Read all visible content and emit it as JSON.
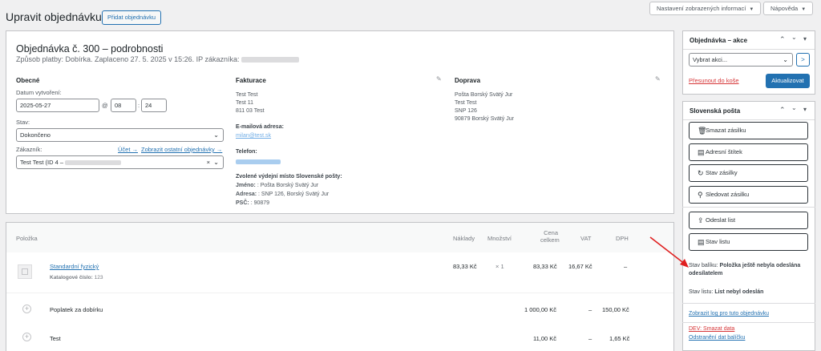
{
  "top": {
    "screen_options": "Nastavení zobrazených informací",
    "help": "Nápověda"
  },
  "page": {
    "title": "Upravit objednávku",
    "add_order": "Přidat objednávku"
  },
  "order": {
    "heading": "Objednávka č. 300 – podrobnosti",
    "meta": "Způsob platby: Dobírka. Zaplaceno 27. 5. 2025 v 15:26. IP zákazníka:",
    "general": {
      "title": "Obecné",
      "date_label": "Datum vytvoření:",
      "date_value": "2025-05-27",
      "at": "@",
      "hour": "08",
      "colon": ":",
      "minute": "24",
      "status_label": "Stav:",
      "status_value": "Dokončeno",
      "customer_label": "Zákazník:",
      "account_link": "Účet →",
      "other_orders_link": "Zobrazit ostatní objednávky →",
      "customer_value": "Test Test (ID 4 –",
      "clear_x": "×"
    },
    "billing": {
      "title": "Fakturace",
      "lines": [
        "Test Test",
        "Test 11",
        "811 03 Test"
      ],
      "email_label": "E-mailová adresa:",
      "email_value": "milan@test.sk",
      "phone_label": "Telefon:",
      "pickup_title": "Zvolené výdejní místo Slovenské pošty:",
      "pickup_name_label": "Jméno:",
      "pickup_name_value": ": Pošta Borský Svätý Jur",
      "pickup_address_label": "Adresa:",
      "pickup_address_value": ": SNP 126, Borský Svätý Jur",
      "pickup_zip_label": "PSČ:",
      "pickup_zip_value": ": 90879"
    },
    "shipping": {
      "title": "Doprava",
      "lines": [
        "Pošta Borský Svätý Jur",
        "Test Test",
        "SNP 126",
        "90879 Borský Svätý Jur"
      ]
    }
  },
  "items": {
    "headers": {
      "item": "Položka",
      "cost": "Náklady",
      "qty": "Množství",
      "total_line1": "Cena",
      "total_line2": "celkem",
      "vat": "VAT",
      "dph": "DPH"
    },
    "product": {
      "name": "Standardní fyzický",
      "sku_label": "Katalogové číslo:",
      "sku_value": "123",
      "cost": "83,33 Kč",
      "qty": "× 1",
      "total": "83,33 Kč",
      "vat": "16,67 Kč",
      "dph": "–"
    },
    "fees": [
      {
        "name": "Poplatek za dobírku",
        "total": "1 000,00 Kč",
        "vat": "–",
        "dph": "150,00 Kč"
      },
      {
        "name": "Test",
        "total": "11,00 Kč",
        "vat": "–",
        "dph": "1,65 Kč"
      }
    ]
  },
  "actions": {
    "title": "Objednávka – akce",
    "select_value": "Vybrat akci...",
    "go": ">",
    "trash": "Přesunout do koše",
    "update": "Aktualizovat"
  },
  "sk_post": {
    "title": "Slovenská pošta",
    "buttons": [
      "Smazat zásilku",
      "Adresní štítek",
      "Stav zásilky",
      "Sledovat zásilku",
      "Odeslat list",
      "Stav listu"
    ],
    "parcel_status_label": "Stav balíku:",
    "parcel_status_value": "Položka ještě nebyla odeslána odesílatelem",
    "list_status_label": "Stav listu:",
    "list_status_value": "List nebyl odeslán",
    "log_link": "Zobrazit log pro tuto objednávku",
    "dev_delete": "DEV: Smazat data",
    "remove_data": "Odstranění dat balíčku"
  },
  "colors": {
    "accent": "#2271b1",
    "danger": "#d63638",
    "annotation_arrow": "#e02020"
  }
}
